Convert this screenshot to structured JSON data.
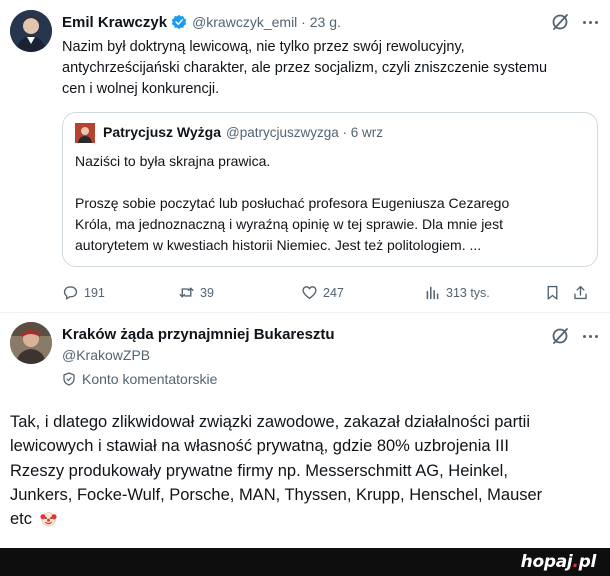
{
  "tweet": {
    "author_name": "Emil Krawczyk",
    "author_handle": "@krawczyk_emil · 23 g.",
    "text_lines": [
      "Nazim był doktryną lewicową, nie tylko przez swój rewolucyjny,",
      "antychrześcijański charakter, ale przez socjalizm, czyli zniszczenie systemu",
      "cen i wolnej konkurencji."
    ],
    "quote": {
      "author_name": "Patrycjusz Wyżga",
      "author_handle": "@patrycjuszwyzga · 6 wrz",
      "line1": "Naziści to była skrajna prawica.",
      "para_lines": [
        "Proszę sobie poczytać lub posłuchać profesora Eugeniusza Cezarego",
        "Króla, ma jednoznaczną i wyraźną opinię w tej sprawie. Dla mnie jest",
        "autorytetem w kwestiach historii Niemiec. Jest też politologiem. ..."
      ]
    },
    "actions": {
      "replies": "191",
      "reposts": "39",
      "likes": "247",
      "views": "313 tys."
    },
    "colors": {
      "verified": "#1d9bf0",
      "icon": "#536471"
    }
  },
  "reply": {
    "author_name": "Kraków żąda przynajmniej Bukaresztu",
    "author_handle": "@KrakowZPB",
    "badge_label": "Konto komentatorskie",
    "text_lines": [
      "Tak, i dlatego zlikwidował związki zawodowe, zakazał działalności partii",
      "lewicowych i stawiał na własność prywatną, gdzie 80% uzbrojenia III",
      "Rzeszy produkowały prywatne firmy np. Messerschmitt AG, Heinkel,",
      "Junkers, Focke-Wulf, Porsche, MAN, Thyssen, Krupp, Henschel, Mauser",
      "etc"
    ],
    "emoji": "clown-face-icon"
  },
  "footer": {
    "logo_main": "hopaj",
    "logo_dot": ".",
    "logo_tld": "pl"
  }
}
